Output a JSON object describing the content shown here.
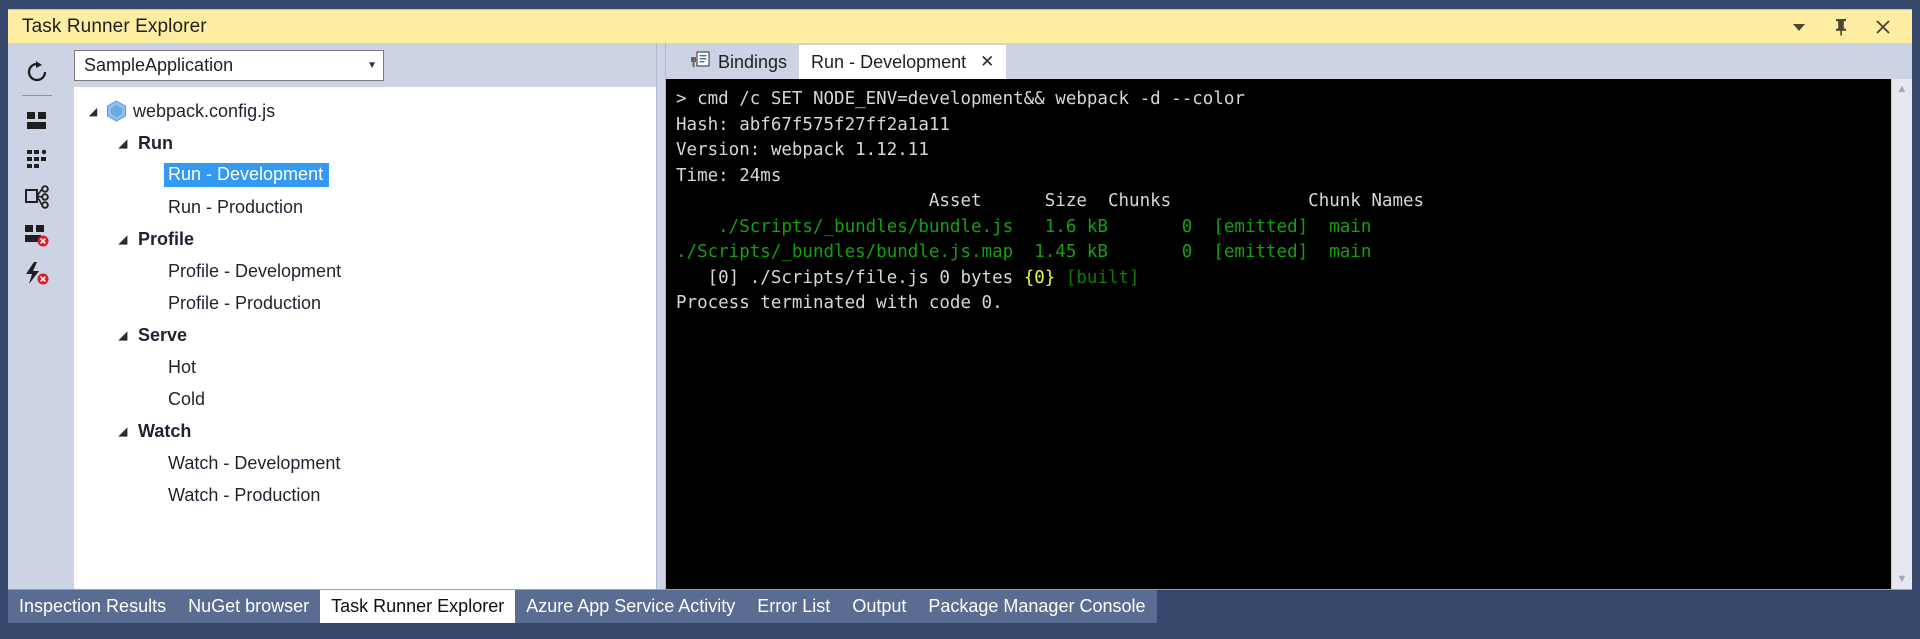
{
  "window": {
    "title": "Task Runner Explorer",
    "controls": [
      {
        "name": "dropdown-menu",
        "glyph": "▼"
      },
      {
        "name": "pin",
        "glyph": "⚐"
      },
      {
        "name": "close",
        "glyph": "✕"
      }
    ]
  },
  "toolbar": {
    "items": [
      {
        "name": "refresh",
        "label": "Refresh"
      },
      {
        "name": "task-list",
        "label": "Task List"
      },
      {
        "name": "task-grid",
        "label": "Task Grid"
      },
      {
        "name": "bindings",
        "label": "Bindings"
      },
      {
        "name": "task-list-error",
        "label": "Task List Errors"
      },
      {
        "name": "run-error",
        "label": "Run Errors"
      }
    ]
  },
  "tree_pane": {
    "project_select": {
      "value": "SampleApplication",
      "caret": "▼"
    },
    "root": {
      "label": "webpack.config.js",
      "expander": "◢",
      "icon": "webpack-hexagon-icon"
    },
    "groups": [
      {
        "label": "Run",
        "expander": "◢",
        "tasks": [
          {
            "label": "Run - Development",
            "selected": true
          },
          {
            "label": "Run - Production",
            "selected": false
          }
        ]
      },
      {
        "label": "Profile",
        "expander": "◢",
        "tasks": [
          {
            "label": "Profile - Development",
            "selected": false
          },
          {
            "label": "Profile - Production",
            "selected": false
          }
        ]
      },
      {
        "label": "Serve",
        "expander": "◢",
        "tasks": [
          {
            "label": "Hot",
            "selected": false
          },
          {
            "label": "Cold",
            "selected": false
          }
        ]
      },
      {
        "label": "Watch",
        "expander": "◢",
        "tasks": [
          {
            "label": "Watch - Development",
            "selected": false
          },
          {
            "label": "Watch - Production",
            "selected": false
          }
        ]
      }
    ]
  },
  "document_tabs": [
    {
      "label": "Bindings",
      "active": false,
      "icon": "bindings-plug-icon",
      "closable": false
    },
    {
      "label": "Run - Development",
      "active": true,
      "icon": null,
      "closable": true,
      "close_glyph": "✕"
    }
  ],
  "console": {
    "lines": [
      {
        "segments": [
          {
            "text": "> cmd /c SET NODE_ENV=development&& webpack -d --color",
            "color": "white"
          }
        ]
      },
      {
        "segments": [
          {
            "text": "Hash: abf67f575f27ff2a1a11",
            "color": "white"
          }
        ]
      },
      {
        "segments": [
          {
            "text": "Version: webpack 1.12.11",
            "color": "white"
          }
        ]
      },
      {
        "segments": [
          {
            "text": "Time: 24ms",
            "color": "white"
          }
        ]
      },
      {
        "segments": [
          {
            "text": "                        Asset      Size  Chunks             Chunk Names",
            "color": "white"
          }
        ]
      },
      {
        "segments": [
          {
            "text": "    ./Scripts/_bundles/bundle.js   1.6 kB       0  [emitted]  main",
            "color": "green"
          }
        ]
      },
      {
        "segments": [
          {
            "text": "./Scripts/_bundles/bundle.js.map  1.45 kB       0  [emitted]  main",
            "color": "green"
          }
        ]
      },
      {
        "segments": [
          {
            "text": "   [0] ./Scripts/file.js 0 bytes ",
            "color": "white"
          },
          {
            "text": "{0}",
            "color": "yellow"
          },
          {
            "text": " [built]",
            "color": "dgreen"
          }
        ]
      },
      {
        "segments": [
          {
            "text": "Process terminated with code 0.",
            "color": "white"
          }
        ]
      }
    ],
    "scrollbar": {
      "up_glyph": "▲",
      "down_glyph": "▼"
    }
  },
  "bottom_tabs": [
    {
      "label": "Inspection Results",
      "active": false
    },
    {
      "label": "NuGet browser",
      "active": false
    },
    {
      "label": "Task Runner Explorer",
      "active": true
    },
    {
      "label": "Azure App Service Activity",
      "active": false
    },
    {
      "label": "Error List",
      "active": false
    },
    {
      "label": "Output",
      "active": false
    },
    {
      "label": "Package Manager Console",
      "active": false
    }
  ],
  "colors": {
    "frame": "#37476b",
    "title_bar": "#ffeea2",
    "toolbar": "#ccd3e4",
    "selection": "#3399f3",
    "console_bg": "#000000",
    "console_green": "#13a10e",
    "console_yellow": "#f5f54a",
    "bottom_bar": "#5a6c91"
  }
}
